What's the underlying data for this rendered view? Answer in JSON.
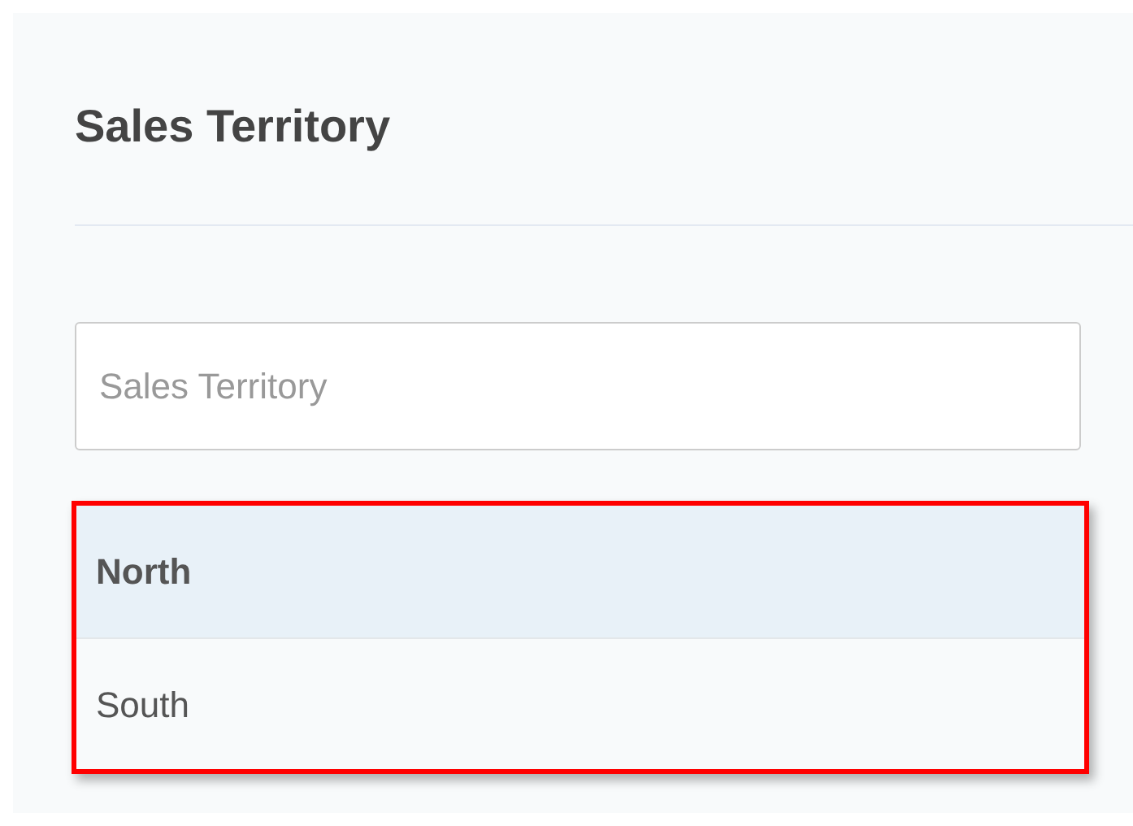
{
  "panel": {
    "title": "Sales Territory"
  },
  "search": {
    "placeholder": "Sales Territory"
  },
  "options": [
    {
      "label": "North",
      "selected": true
    },
    {
      "label": "South",
      "selected": false
    }
  ]
}
